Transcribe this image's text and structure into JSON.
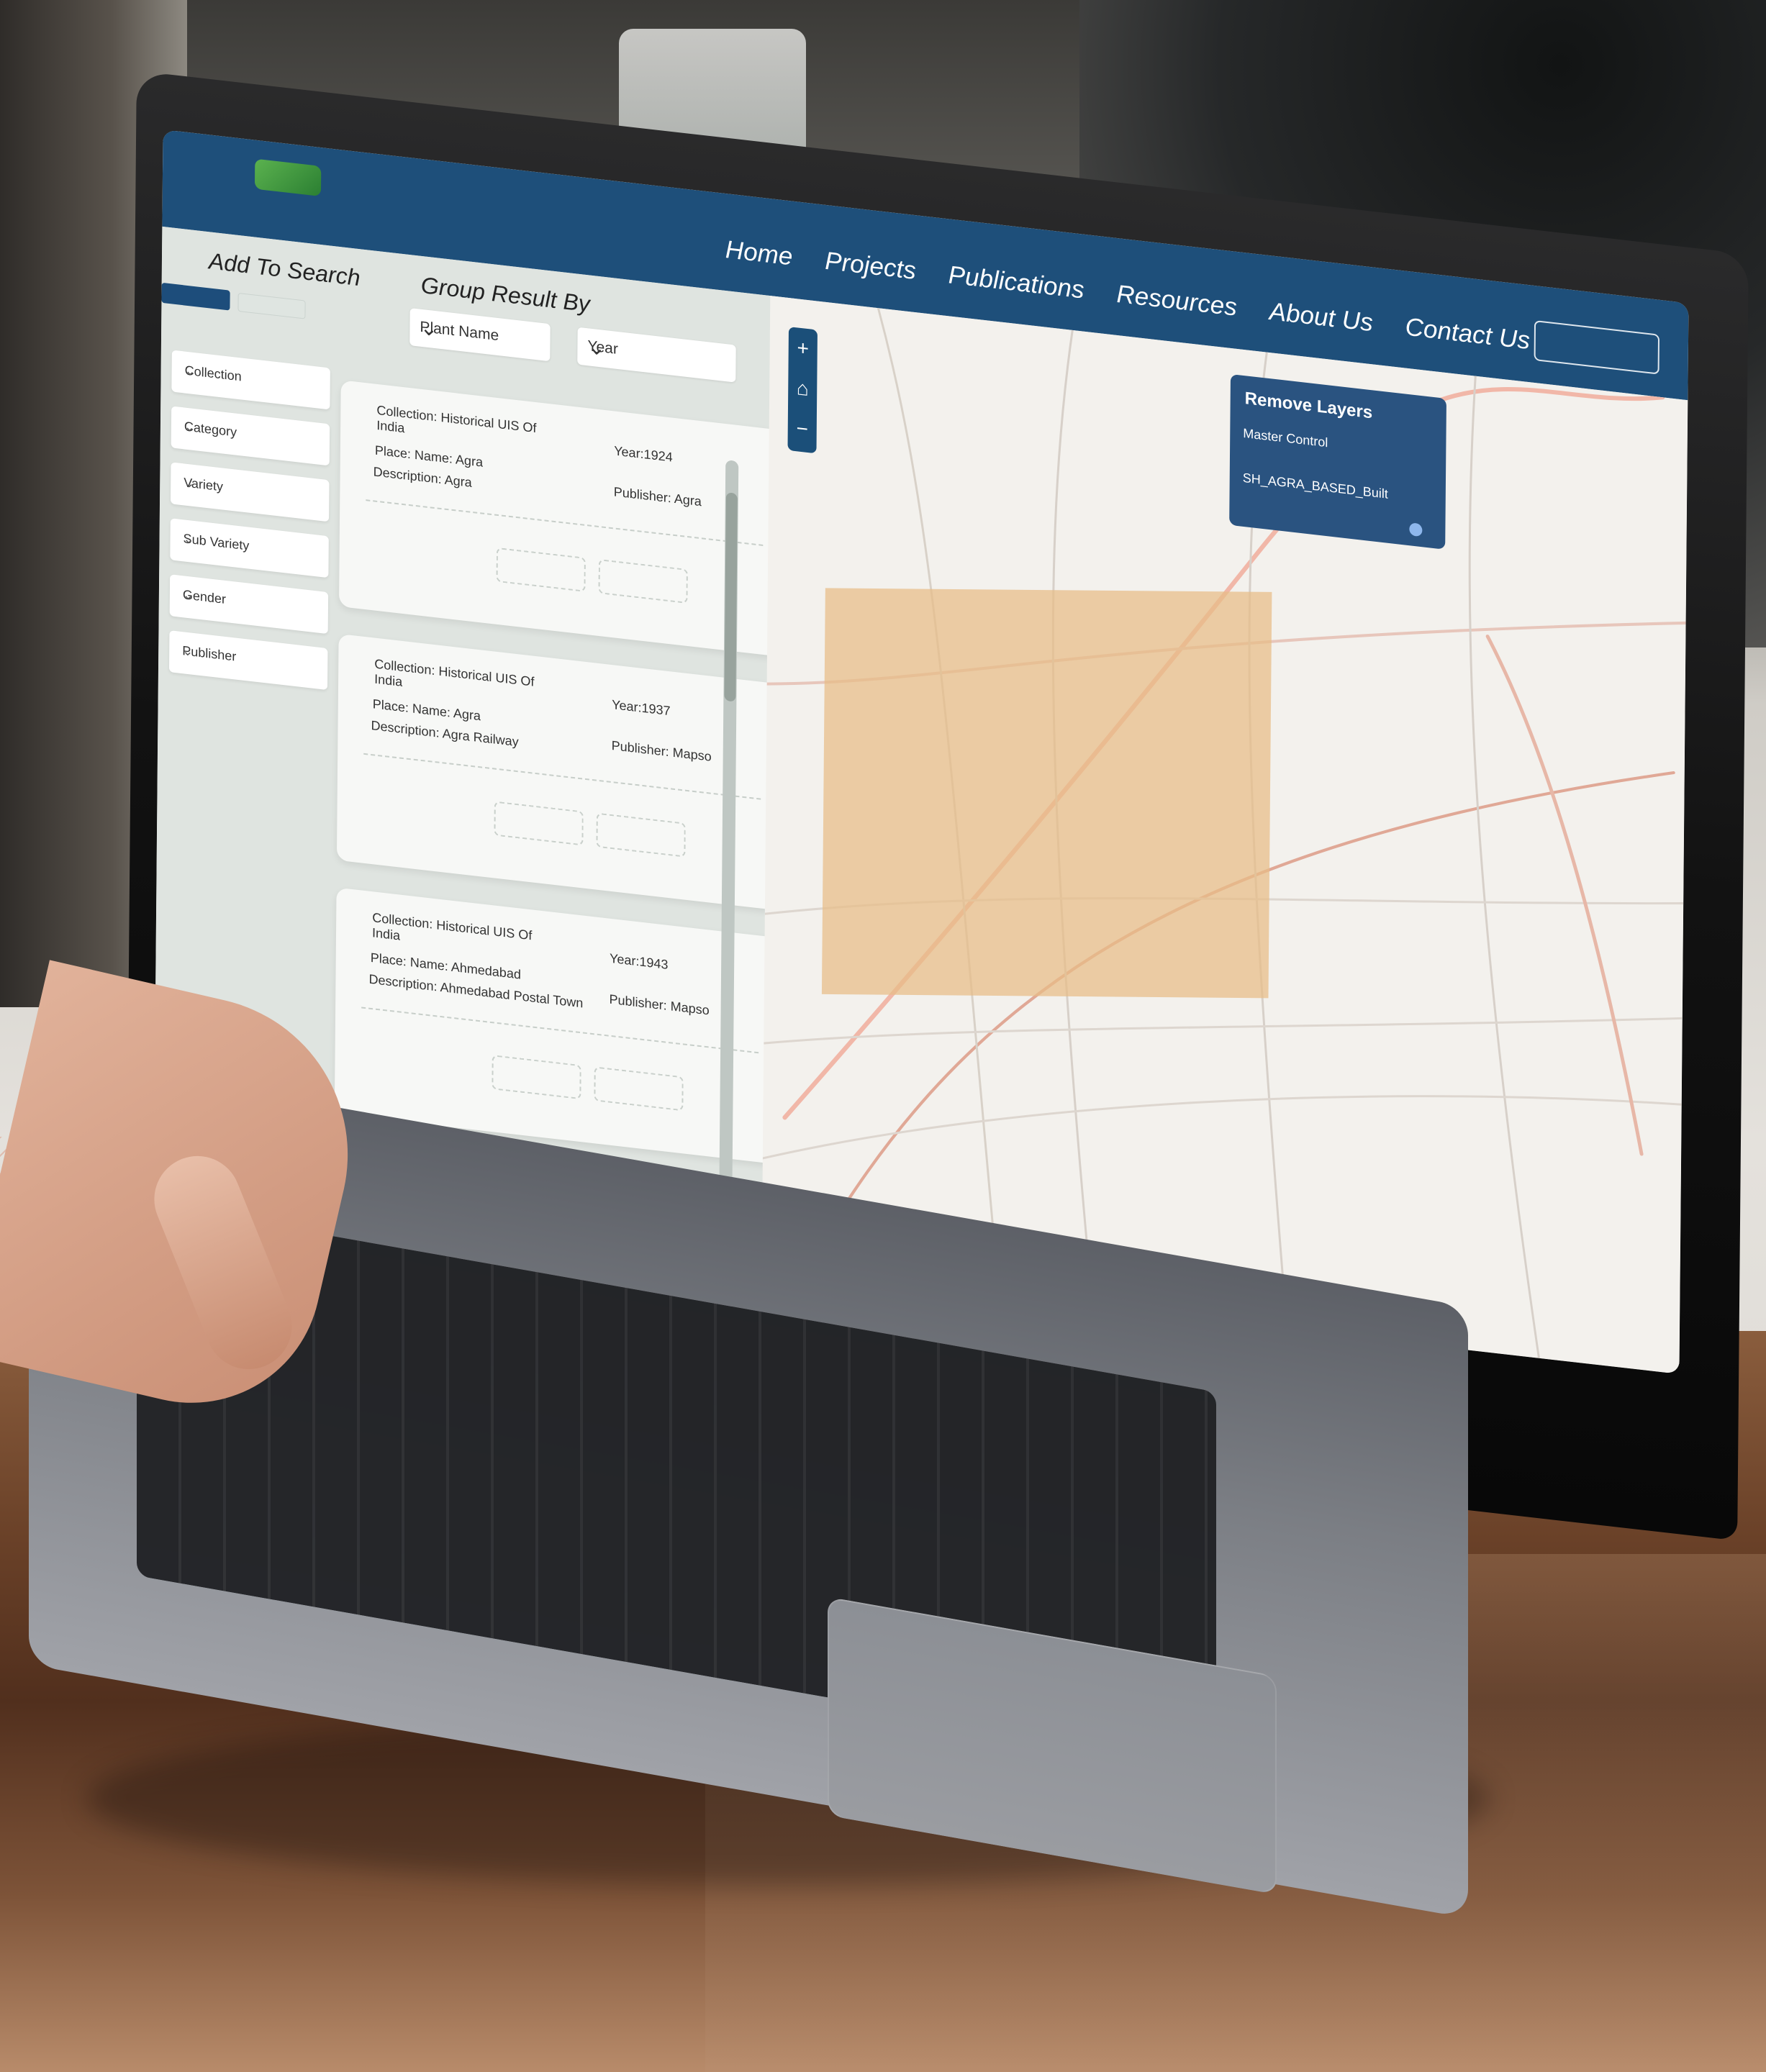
{
  "site": {
    "logo_text": "",
    "nav": [
      "Home",
      "Projects",
      "Publications",
      "Resources",
      "About Us",
      "Contact Us"
    ]
  },
  "search": {
    "add_to_search": "Add To Search",
    "group_result_by": "Group Result By",
    "select_1": "Plant Name",
    "select_2": "Year",
    "filters": [
      "Collection",
      "Category",
      "Variety",
      "Sub Variety",
      "Gender",
      "Publisher"
    ]
  },
  "cards": [
    {
      "line1": "Collection: Historical UIS Of India",
      "line2": "Place: Name: Agra",
      "line3": "Description: Agra",
      "right1": "Year:1924",
      "right2": "Publisher: Agra"
    },
    {
      "line1": "Collection: Historical UIS Of India",
      "line2": "Place: Name: Agra",
      "line3": "Description: Agra Railway",
      "right1": "Year:1937",
      "right2": "Publisher: Mapso"
    },
    {
      "line1": "Collection: Historical UIS Of India",
      "line2": "Place: Name: Ahmedabad",
      "line3": "Description: Ahmedabad Postal Town",
      "right1": "Year:1943",
      "right2": "Publisher: Mapso"
    }
  ],
  "map": {
    "remove_layers": "Remove Layers",
    "layer_1": "Master Control",
    "layer_2": "SH_AGRA_BASED_Built",
    "zoom_in": "+",
    "zoom_home": "⌂",
    "zoom_out": "−"
  }
}
